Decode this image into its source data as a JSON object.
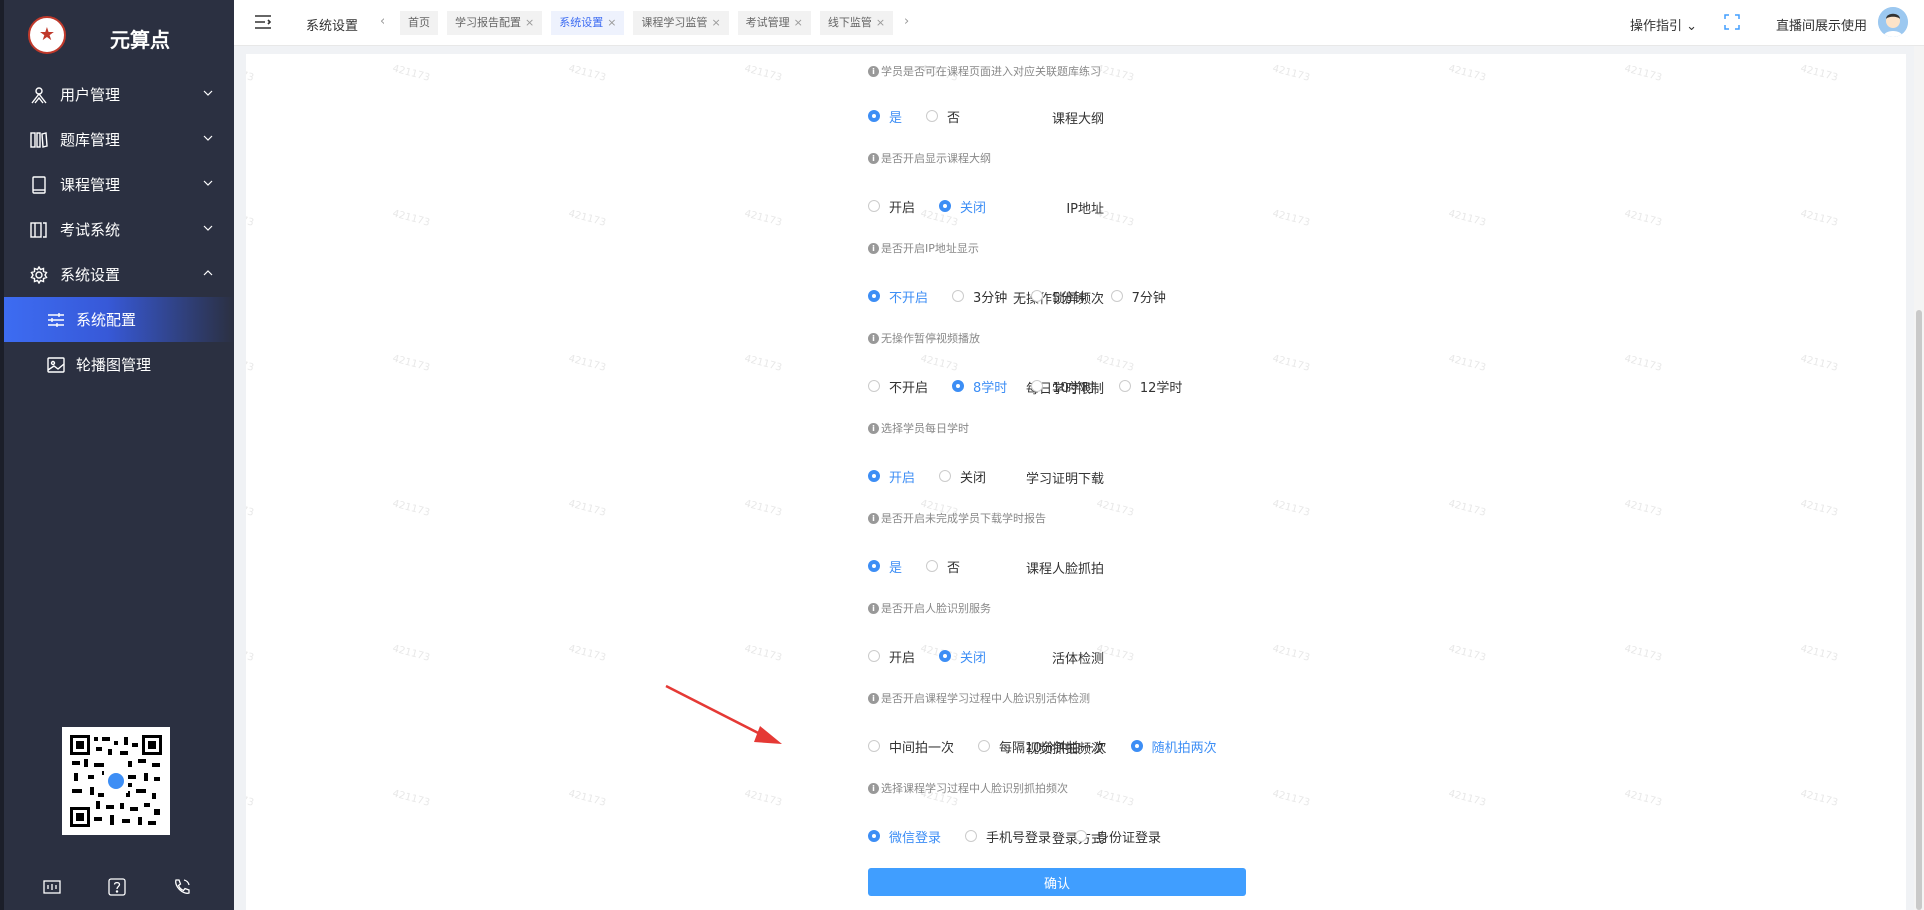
{
  "sidebar": {
    "brand": "元算点",
    "menu": [
      {
        "label": "用户管理",
        "icon": "user-icon",
        "expanded": false
      },
      {
        "label": "题库管理",
        "icon": "books-icon",
        "expanded": false
      },
      {
        "label": "课程管理",
        "icon": "book-icon",
        "expanded": false
      },
      {
        "label": "考试系统",
        "icon": "exam-icon",
        "expanded": false
      },
      {
        "label": "系统设置",
        "icon": "gear-icon",
        "expanded": true
      }
    ],
    "submenu": [
      {
        "label": "系统配置",
        "icon": "sliders-icon",
        "active": true
      },
      {
        "label": "轮播图管理",
        "icon": "image-icon",
        "active": false
      }
    ],
    "bottom_icons": [
      "console-icon",
      "help-icon",
      "phone-icon"
    ]
  },
  "topbar": {
    "breadcrumb": "系统设置",
    "tabs": [
      {
        "label": "首页",
        "closable": false,
        "active": false
      },
      {
        "label": "学习报告配置",
        "closable": true,
        "active": false
      },
      {
        "label": "系统设置",
        "closable": true,
        "active": true
      },
      {
        "label": "课程学习监管",
        "closable": true,
        "active": false
      },
      {
        "label": "考试管理",
        "closable": true,
        "active": false
      },
      {
        "label": "线下监管",
        "closable": true,
        "active": false
      }
    ],
    "guide": "操作指引",
    "user": "直播间展示使用"
  },
  "watermark": "421173",
  "form": {
    "top_hint": "学员是否可在课程页面进入对应关联题库练习",
    "rows": [
      {
        "label": "课程大纲",
        "options": [
          "是",
          "否"
        ],
        "selected": 0,
        "hint": "是否开启显示课程大纲"
      },
      {
        "label": "IP地址",
        "options": [
          "开启",
          "关闭"
        ],
        "selected": 1,
        "hint": "是否开启IP地址显示"
      },
      {
        "label": "无操作锁屏频次",
        "options": [
          "不开启",
          "3分钟",
          "5分钟",
          "7分钟"
        ],
        "selected": 0,
        "hint": "无操作暂停视频播放"
      },
      {
        "label": "每日学时限制",
        "options": [
          "不开启",
          "8学时",
          "10学时",
          "12学时"
        ],
        "selected": 1,
        "hint": "选择学员每日学时"
      },
      {
        "label": "学习证明下载",
        "options": [
          "开启",
          "关闭"
        ],
        "selected": 0,
        "hint": "是否开启未完成学员下载学时报告"
      },
      {
        "label": "课程人脸抓拍",
        "options": [
          "是",
          "否"
        ],
        "selected": 0,
        "hint": "是否开启人脸识别服务"
      },
      {
        "label": "活体检测",
        "options": [
          "开启",
          "关闭"
        ],
        "selected": 1,
        "hint": "是否开启课程学习过程中人脸识别活体检测"
      },
      {
        "label": "视频抓拍频次",
        "options": [
          "中间拍一次",
          "每隔10分钟拍一次",
          "随机拍两次"
        ],
        "selected": 2,
        "hint": "选择课程学习过程中人脸识别抓拍频次"
      },
      {
        "label": "登录方式",
        "options": [
          "微信登录",
          "手机号登录",
          "身份证登录"
        ],
        "selected": 0,
        "hint": ""
      }
    ],
    "confirm_label": "确认"
  },
  "colors": {
    "accent": "#409eff",
    "sidebar_bg": "#2b3041",
    "active_menu": "#3d6cf2",
    "annotation_arrow": "#e53935"
  }
}
